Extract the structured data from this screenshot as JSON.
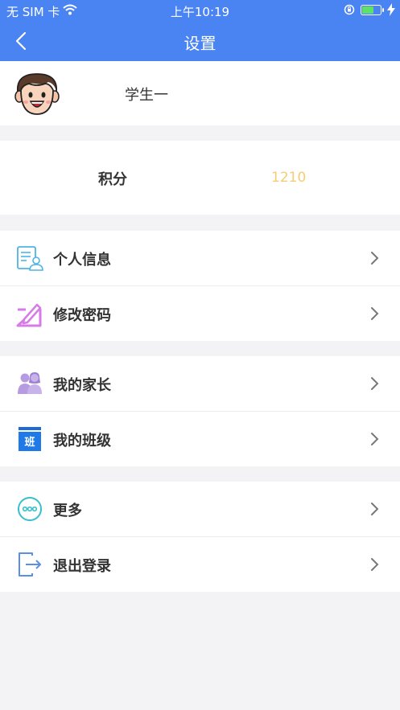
{
  "status_bar": {
    "carrier": "无 SIM 卡",
    "time": "上午10:19"
  },
  "navbar": {
    "title": "设置",
    "back_icon": "chevron-left-icon"
  },
  "profile": {
    "name": "学生一",
    "avatar_icon": "student-avatar-icon"
  },
  "points": {
    "label": "积分",
    "value": "1210",
    "value_color": "#f5cd73"
  },
  "menu": {
    "personal_info": {
      "label": "个人信息",
      "icon": "profile-card-icon"
    },
    "change_password": {
      "label": "修改密码",
      "icon": "edit-password-icon"
    },
    "my_parents": {
      "label": "我的家长",
      "icon": "parents-icon"
    },
    "my_class": {
      "label": "我的班级",
      "icon": "class-icon",
      "icon_text": "班"
    },
    "more": {
      "label": "更多",
      "icon": "more-icon"
    },
    "logout": {
      "label": "退出登录",
      "icon": "logout-icon"
    }
  },
  "colors": {
    "primary": "#4a83f2",
    "background": "#f3f2f4",
    "points_value": "#f5cd73"
  }
}
